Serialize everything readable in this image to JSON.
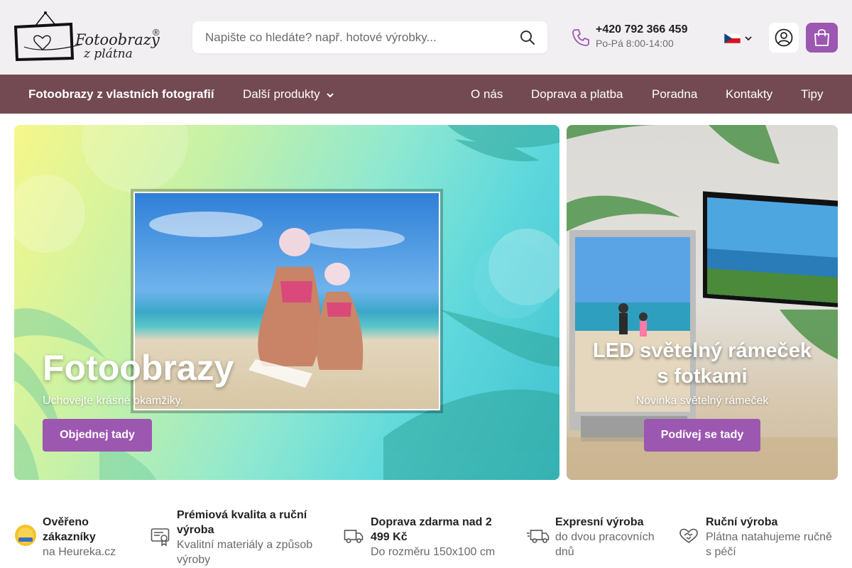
{
  "logo": {
    "text_line1": "Fotoobrazy",
    "text_line2": "z plátna",
    "registered": "®"
  },
  "search": {
    "placeholder": "Napište co hledáte? např. hotové výrobky..."
  },
  "contact": {
    "phone": "+420 792 366 459",
    "hours": "Po-Pá 8:00-14:00"
  },
  "language": {
    "selected": "cz-flag"
  },
  "nav": {
    "items": [
      {
        "label": "Fotoobrazy z vlastních fotografií"
      },
      {
        "label": "Další produkty"
      },
      {
        "label": "O nás"
      },
      {
        "label": "Doprava a platba"
      },
      {
        "label": "Poradna"
      },
      {
        "label": "Kontakty"
      },
      {
        "label": "Tipy"
      }
    ]
  },
  "hero": {
    "left": {
      "title": "Fotoobrazy",
      "subtitle": "Uchovejte krásné okamžiky.",
      "button": "Objednej tady"
    },
    "right": {
      "title_line1": "LED světelný rámeček",
      "title_line2": "s fotkami",
      "subtitle": "Novinka světelný rámeček",
      "button": "Podívej se tady"
    }
  },
  "usps": [
    {
      "icon": "heureka-badge-icon",
      "title_line1": "Ověřeno",
      "title_line2": "zákazníky",
      "sub_line1": "na Heureka.cz",
      "sub_line2": ""
    },
    {
      "icon": "certificate-icon",
      "title_line1": "Prémiová kvalita a ruční",
      "title_line2": "výroba",
      "sub_line1": "Kvalitní materiály a způsob",
      "sub_line2": "výroby"
    },
    {
      "icon": "truck-icon",
      "title_line1": "Doprava zdarma nad 2",
      "title_line2": "499 Kč",
      "sub_line1": "Do rozměru 150x100 cm",
      "sub_line2": ""
    },
    {
      "icon": "fast-truck-icon",
      "title_line1": "Expresní výroba",
      "title_line2": "",
      "sub_line1": "do dvou pracovních",
      "sub_line2": "dnů"
    },
    {
      "icon": "handshake-icon",
      "title_line1": "Ruční výroba",
      "title_line2": "",
      "sub_line1": "Plátna natahujeme ručně",
      "sub_line2": "s péčí"
    }
  ],
  "colors": {
    "accent": "#9c57b0",
    "nav_bg": "#734a51",
    "header_bg": "#f2eff2"
  }
}
